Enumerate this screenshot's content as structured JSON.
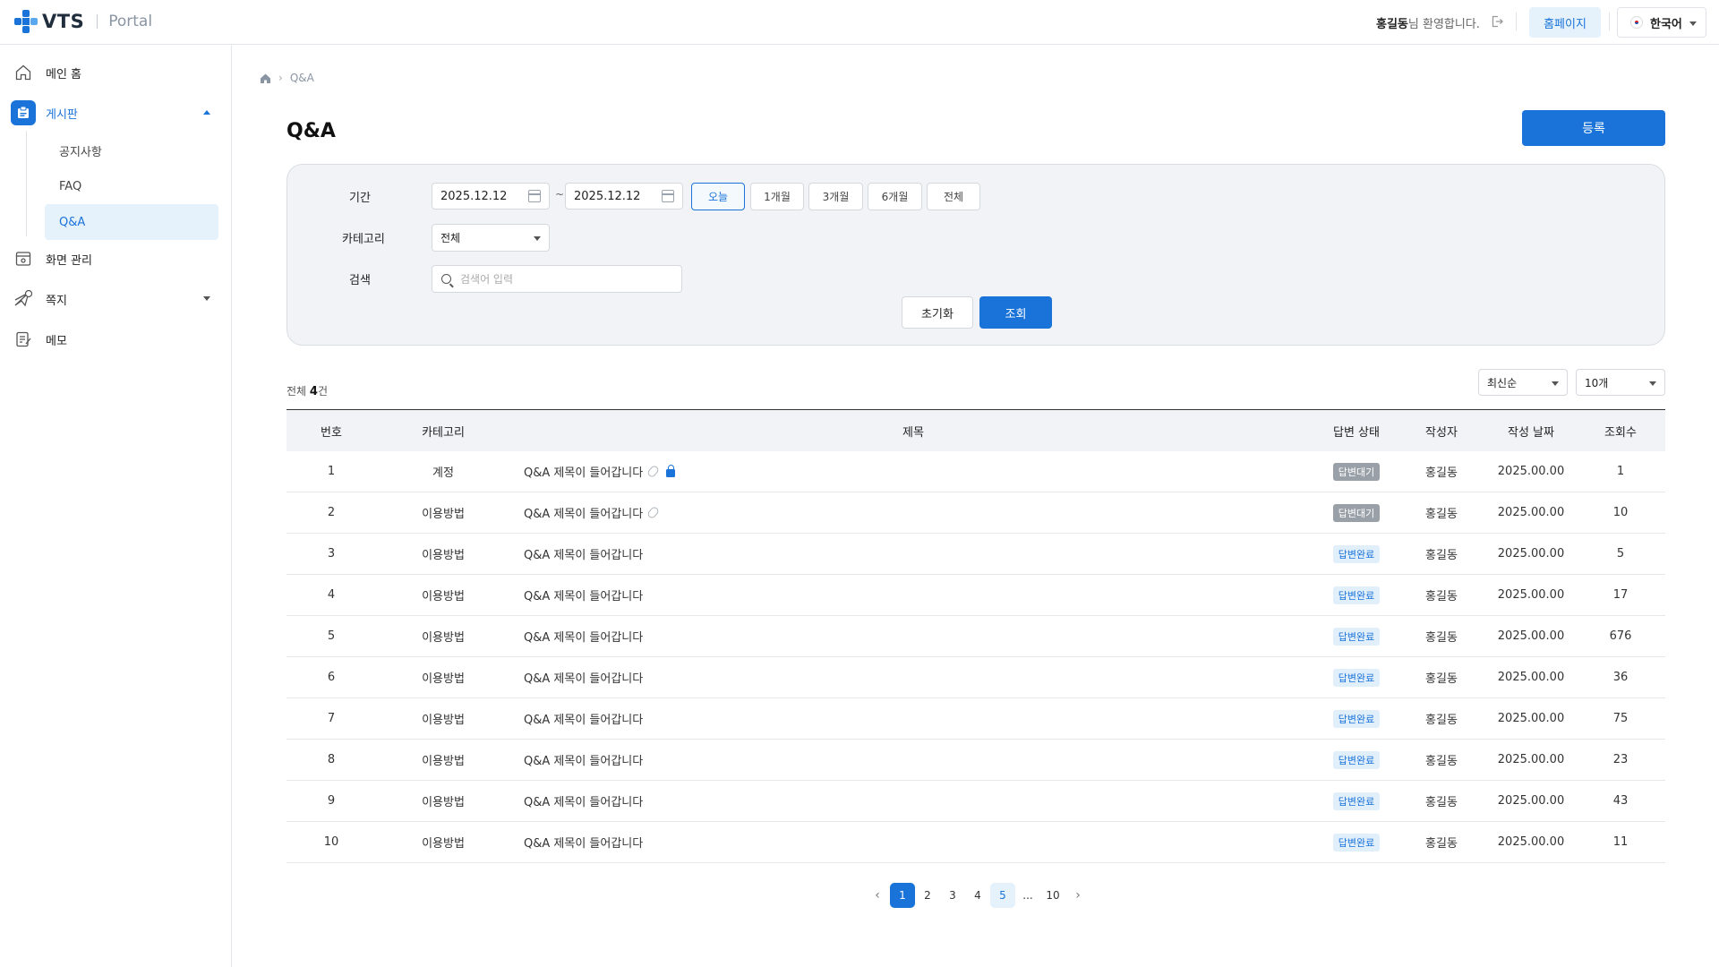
{
  "header": {
    "logo_text": "VTS",
    "logo_sub": "Portal",
    "user_name": "홍길동",
    "welcome_suffix": "님 환영합니다.",
    "homepage_label": "홈페이지",
    "language": "한국어"
  },
  "sidebar": {
    "items": [
      {
        "label": "메인 홈",
        "icon": "home-icon"
      },
      {
        "label": "게시판",
        "icon": "board-icon"
      },
      {
        "label": "화면 관리",
        "icon": "screen-icon"
      },
      {
        "label": "쪽지",
        "icon": "message-icon"
      },
      {
        "label": "메모",
        "icon": "memo-icon"
      }
    ],
    "sub_items": [
      {
        "label": "공지사항"
      },
      {
        "label": "FAQ"
      },
      {
        "label": "Q&A"
      }
    ]
  },
  "breadcrumb": {
    "current": "Q&A"
  },
  "page": {
    "title": "Q&A",
    "register_label": "등록"
  },
  "filter": {
    "period_label": "기간",
    "date_from": "2025.12.12",
    "date_to": "2025.12.12",
    "tilde": "~",
    "period_buttons": [
      "오늘",
      "1개월",
      "3개월",
      "6개월",
      "전체"
    ],
    "selected_period": "오늘",
    "category_label": "카테고리",
    "category_value": "전체",
    "search_label": "검색",
    "search_placeholder": "검색어 입력",
    "reset_label": "초기화",
    "query_label": "조회"
  },
  "list": {
    "total_prefix": "전체",
    "total_count": "4",
    "total_suffix": "건",
    "sort_value": "최신순",
    "page_size_value": "10개",
    "columns": [
      "번호",
      "카테고리",
      "제목",
      "답변 상태",
      "작성자",
      "작성 날짜",
      "조회수"
    ],
    "rows": [
      {
        "no": "1",
        "category": "계정",
        "title": "Q&A 제목이 들어갑니다",
        "status": "답변대기",
        "writer": "홍길동",
        "date": "2025.00.00",
        "views": "1"
      },
      {
        "no": "2",
        "category": "이용방법",
        "title": "Q&A 제목이 들어갑니다",
        "status": "답변대기",
        "writer": "홍길동",
        "date": "2025.00.00",
        "views": "10"
      },
      {
        "no": "3",
        "category": "이용방법",
        "title": "Q&A 제목이 들어갑니다",
        "status": "답변완료",
        "writer": "홍길동",
        "date": "2025.00.00",
        "views": "5"
      },
      {
        "no": "4",
        "category": "이용방법",
        "title": "Q&A 제목이 들어갑니다",
        "status": "답변완료",
        "writer": "홍길동",
        "date": "2025.00.00",
        "views": "17"
      },
      {
        "no": "5",
        "category": "이용방법",
        "title": "Q&A 제목이 들어갑니다",
        "status": "답변완료",
        "writer": "홍길동",
        "date": "2025.00.00",
        "views": "676"
      },
      {
        "no": "6",
        "category": "이용방법",
        "title": "Q&A 제목이 들어갑니다",
        "status": "답변완료",
        "writer": "홍길동",
        "date": "2025.00.00",
        "views": "36"
      },
      {
        "no": "7",
        "category": "이용방법",
        "title": "Q&A 제목이 들어갑니다",
        "status": "답변완료",
        "writer": "홍길동",
        "date": "2025.00.00",
        "views": "75"
      },
      {
        "no": "8",
        "category": "이용방법",
        "title": "Q&A 제목이 들어갑니다",
        "status": "답변완료",
        "writer": "홍길동",
        "date": "2025.00.00",
        "views": "23"
      },
      {
        "no": "9",
        "category": "이용방법",
        "title": "Q&A 제목이 들어갑니다",
        "status": "답변완료",
        "writer": "홍길동",
        "date": "2025.00.00",
        "views": "43"
      },
      {
        "no": "10",
        "category": "이용방법",
        "title": "Q&A 제목이 들어갑니다",
        "status": "답변완료",
        "writer": "홍길동",
        "date": "2025.00.00",
        "views": "11"
      }
    ]
  },
  "pagination": {
    "pages": [
      "1",
      "2",
      "3",
      "4",
      "5",
      "...",
      "10"
    ],
    "current": "1"
  },
  "colors": {
    "accent": "#1a73d9",
    "accent_light": "#e5f2fc",
    "badge_wait": "#9aa0a8"
  }
}
